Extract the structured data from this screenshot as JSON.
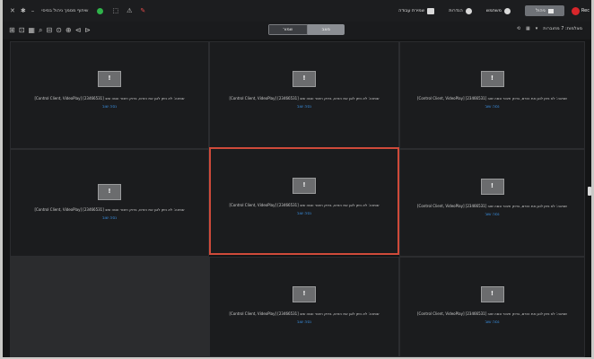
{
  "window": {
    "title": "שיתוף מסמך ניהול בסיסי",
    "window_controls": [
      "✕",
      "✱",
      "–"
    ]
  },
  "toolbar_glyphs": [
    "⬚",
    "⚠",
    "✎"
  ],
  "menu": [
    {
      "label": "שמירת עבודה",
      "icon": "save-icon"
    },
    {
      "label": "הגדרות",
      "icon": "info-icon"
    },
    {
      "label": "משתמש",
      "icon": "gear-icon"
    }
  ],
  "active_tab": {
    "label": "ניהול"
  },
  "red_tab": {
    "label": "Rec"
  },
  "toolbar2": {
    "icons": [
      "⊞",
      "⊡",
      "▦",
      "⌕",
      "⊟",
      "⊙",
      "⊕",
      "⊲",
      "⊳"
    ],
    "segment": {
      "left": "שמור",
      "right": "מצב"
    },
    "right_text": "מצלמות: 7 מחוברות",
    "right_icons": [
      "⟲",
      "▦",
      "▾"
    ]
  },
  "tiles": [
    {
      "message": "[Control Client, VideoPlay] [23466531] שגיאה: לא ניתן לנגן את הזרם, בדוק חיבור ונסה שוב",
      "action": "נסה שוב"
    },
    {
      "message": "[Control Client, VideoPlay] [23466531] שגיאה: לא ניתן לנגן את הזרם, בדוק חיבור ונסה שוב",
      "action": "נסה שוב"
    },
    {
      "message": "[Control Client, VideoPlay] [23466531] שגיאה: לא ניתן לנגן את הזרם, בדוק חיבור ונסה שוב",
      "action": "נסה שוב"
    },
    {
      "message": "[Control Client, VideoPlay] [23466531] שגיאה: לא ניתן לנגן את הזרם, בדוק חיבור ונסה שוב",
      "action": "נסה שוב"
    },
    {
      "message": "[Control Client, VideoPlay] [23466531] שגיאה: לא ניתן לנגן את הזרם, בדוק חיבור ונסה שוב",
      "action": "נסה שוב"
    },
    {
      "message": "[Control Client, VideoPlay] [23466531] שגיאה: לא ניתן לנגן את הזרם, בדוק חיבור ונסה שוב",
      "action": "נסה שוב"
    },
    {
      "message": "[Control Client, VideoPlay] [23466531] שגיאה: לא ניתן לנגן את הזרם, בדוק חיבור ונסה שוב",
      "action": "נסה שוב"
    },
    {
      "message": "[Control Client, VideoPlay] [23466531] שגיאה: לא ניתן לנגן את הזרם, בדוק חיבור ונסה שוב",
      "action": "נסה שוב"
    }
  ],
  "tile_placeholder_glyph": "!",
  "colors": {
    "selected_border": "#cf4a3a",
    "link": "#3a8fe0",
    "status_green": "#2fb34a",
    "record_red": "#d8262b"
  }
}
